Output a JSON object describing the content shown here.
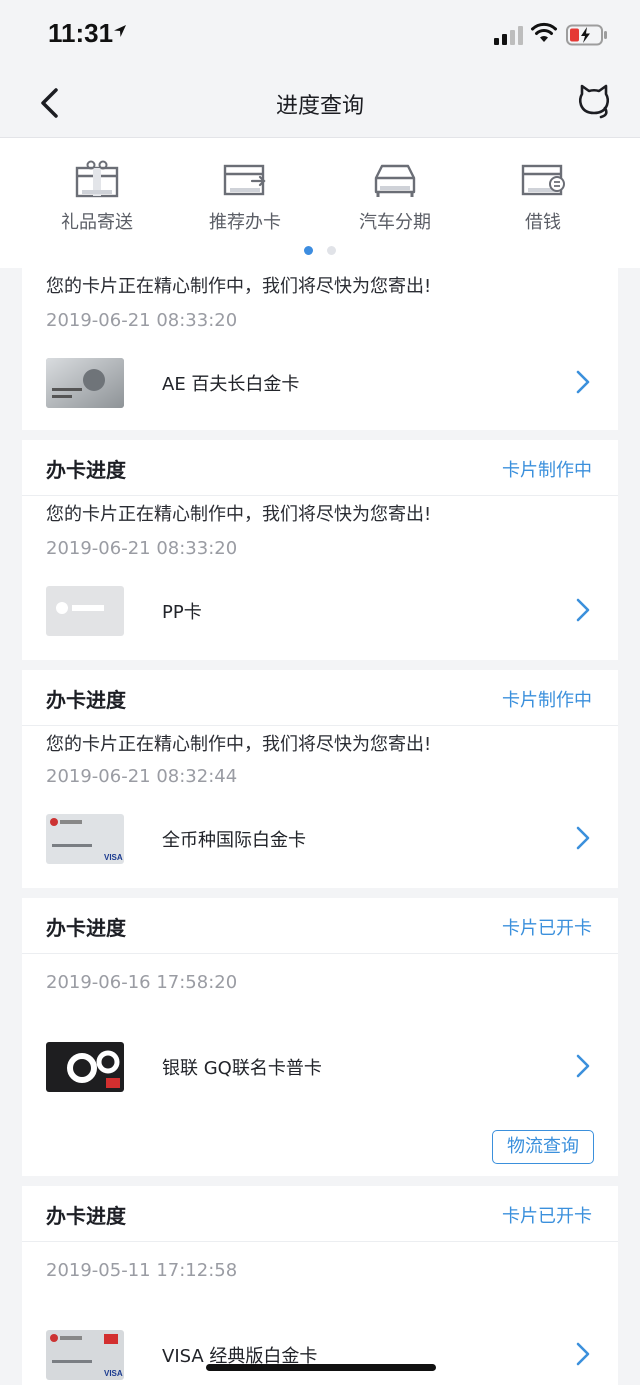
{
  "status_bar": {
    "time": "11:31"
  },
  "nav": {
    "title": "进度查询"
  },
  "shortcuts": [
    {
      "label": "礼品寄送",
      "icon": "gift-icon"
    },
    {
      "label": "推荐办卡",
      "icon": "recommend-card-icon"
    },
    {
      "label": "汽车分期",
      "icon": "car-icon"
    },
    {
      "label": "借钱",
      "icon": "borrow-icon"
    }
  ],
  "cards": [
    {
      "title": "",
      "status": "",
      "message": "您的卡片正在精心制作中，我们将尽快为您寄出!",
      "time": "2019-06-21 08:33:20",
      "product": "AE 百夫长白金卡",
      "thumb": "amex-card-thumbnail"
    },
    {
      "title": "办卡进度",
      "status": "卡片制作中",
      "message": "您的卡片正在精心制作中，我们将尽快为您寄出!",
      "time": "2019-06-21 08:33:20",
      "product": "PP卡",
      "thumb": "pp-card-thumbnail"
    },
    {
      "title": "办卡进度",
      "status": "卡片制作中",
      "message": "您的卡片正在精心制作中，我们将尽快为您寄出!",
      "time": "2019-06-21 08:32:44",
      "product": "全币种国际白金卡",
      "thumb": "visa-platinum-thumbnail"
    },
    {
      "title": "办卡进度",
      "status": "卡片已开卡",
      "message": "",
      "time": "2019-06-16 17:58:20",
      "product": "银联 GQ联名卡普卡",
      "thumb": "gq-card-thumbnail",
      "action": "物流查询"
    },
    {
      "title": "办卡进度",
      "status": "卡片已开卡",
      "message": "",
      "time": "2019-05-11 17:12:58",
      "product": "VISA 经典版白金卡",
      "thumb": "visa-classic-thumbnail"
    }
  ],
  "colors": {
    "accent": "#3b90dc",
    "background": "#f3f4f6"
  }
}
